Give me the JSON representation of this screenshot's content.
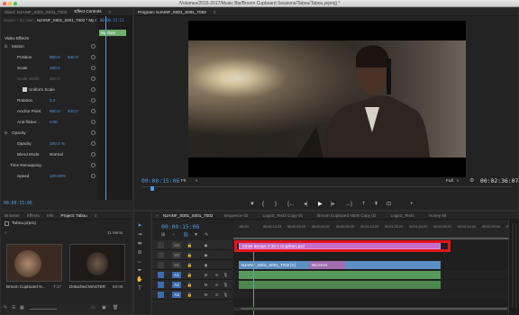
{
  "window": {
    "title": "/Volumes/2016-2017/Music Biz/Broom Cupboard Sessions/Tabou/Tabou.prproj) *"
  },
  "source_tabs": [
    {
      "label": "Mixer: NJAINF_S001_S001_T002",
      "active": false
    },
    {
      "label": "Effect Controls",
      "active": true
    },
    {
      "label": "≡",
      "active": false
    }
  ],
  "effect_controls": {
    "master_label": "Master * My Own",
    "sequence_label": "NJAINF_S001_S001_T002 * My Own",
    "ruler_time": "00:00:15:11",
    "clip_bar_label": "My Own",
    "section_video_effects": "Video Effects",
    "rows": [
      {
        "indent": 1,
        "fx": "fx",
        "label": "Motion",
        "value": "",
        "value2": ""
      },
      {
        "indent": 2,
        "fx": "",
        "label": "Position",
        "value": "960.0",
        "value2": "540.0"
      },
      {
        "indent": 2,
        "fx": "",
        "label": "Scale",
        "value": "100.0",
        "value2": ""
      },
      {
        "indent": 2,
        "fx": "",
        "label": "Scale Width",
        "value": "100.0",
        "value2": "",
        "disabled": true
      },
      {
        "indent": 3,
        "fx": "",
        "label": "Uniform Scale",
        "value": "",
        "value2": "",
        "checkbox": true
      },
      {
        "indent": 2,
        "fx": "",
        "label": "Rotation",
        "value": "0.0",
        "value2": ""
      },
      {
        "indent": 2,
        "fx": "",
        "label": "Anchor Point",
        "value": "960.0",
        "value2": "540.0"
      },
      {
        "indent": 2,
        "fx": "",
        "label": "Anti-flicker...",
        "value": "0.00",
        "value2": ""
      },
      {
        "indent": 1,
        "fx": "fx",
        "label": "Opacity",
        "value": "",
        "value2": ""
      },
      {
        "indent": 2,
        "fx": "",
        "label": "Opacity",
        "value": "100.0 %",
        "value2": ""
      },
      {
        "indent": 2,
        "fx": "",
        "label": "Blend Mode",
        "value": "Normal",
        "value2": ""
      },
      {
        "indent": 1,
        "fx": "",
        "label": "Time Remapping",
        "value": "",
        "value2": ""
      },
      {
        "indent": 2,
        "fx": "",
        "label": "Speed",
        "value": "100.00%",
        "value2": ""
      }
    ],
    "timecode": "00:00:15:06"
  },
  "program": {
    "tab_label": "Program: NJAINF_S001_S001_T002",
    "current_time": "00:00:15:06",
    "fit_label": "Fit",
    "quality_label": "Full",
    "duration": "00:02:36:07"
  },
  "transport": [
    "{",
    "{",
    "}",
    "{←",
    "◁|",
    "▶",
    "|▷",
    "→}",
    "⧉",
    "⧉",
    "⊡",
    "+"
  ],
  "project": {
    "tabs": [
      {
        "label": "Browser",
        "active": false
      },
      {
        "label": "Effects",
        "active": false
      },
      {
        "label": "Info",
        "active": false
      },
      {
        "label": "Project: Tabou",
        "active": true
      }
    ],
    "file": "Tabou.prproj",
    "item_count": "11 Items",
    "items": [
      {
        "name": "Broom Cupboard N...",
        "duration": "7:17",
        "color": "#7a5a4a"
      },
      {
        "name": "Detached MASTER",
        "duration": "50:06",
        "color": "#5a4636"
      }
    ]
  },
  "timeline": {
    "tabs": [
      {
        "label": "NJAINF_S001_S001_T002",
        "active": true
      },
      {
        "label": "Sequence 02",
        "active": false
      },
      {
        "label": "Logo2_Text2 Copy 01",
        "active": false
      },
      {
        "label": "Broom Cupboard NEW Copy 02",
        "active": false
      },
      {
        "label": "Logo2_Text1",
        "active": false
      },
      {
        "label": "Honey Mi",
        "active": false
      }
    ],
    "current_time": "00:00:15:06",
    "ruler": [
      ":00:00",
      "00:00:14:23",
      "00:00:29:23",
      "00:00:44:22",
      "00:00:59:22",
      "00:01:14:22",
      "00:01:29:21",
      "00:01:44:21",
      "00:01:59:21",
      "00:02:14:20",
      "00:02:29:20",
      "00:02:44:20"
    ],
    "video_tracks": [
      "V3",
      "V2",
      "V1"
    ],
    "audio_tracks": [
      "A1",
      "A2",
      "A3"
    ],
    "graphic_clip_label": "Cinemascope 2-35-1 Croplines.psd",
    "video_clip_label": "NJAINF_S001_S001_T002 [V]",
    "short_clip_label": "NICHI M",
    "highlight_color": "#e0161b",
    "graphic_clip_color": "#cf6fcf"
  },
  "tools": [
    "selection-icon",
    "track-select-icon",
    "ripple-edit-icon",
    "razor-icon",
    "slip-icon",
    "pen-icon",
    "hand-icon",
    "type-icon"
  ]
}
